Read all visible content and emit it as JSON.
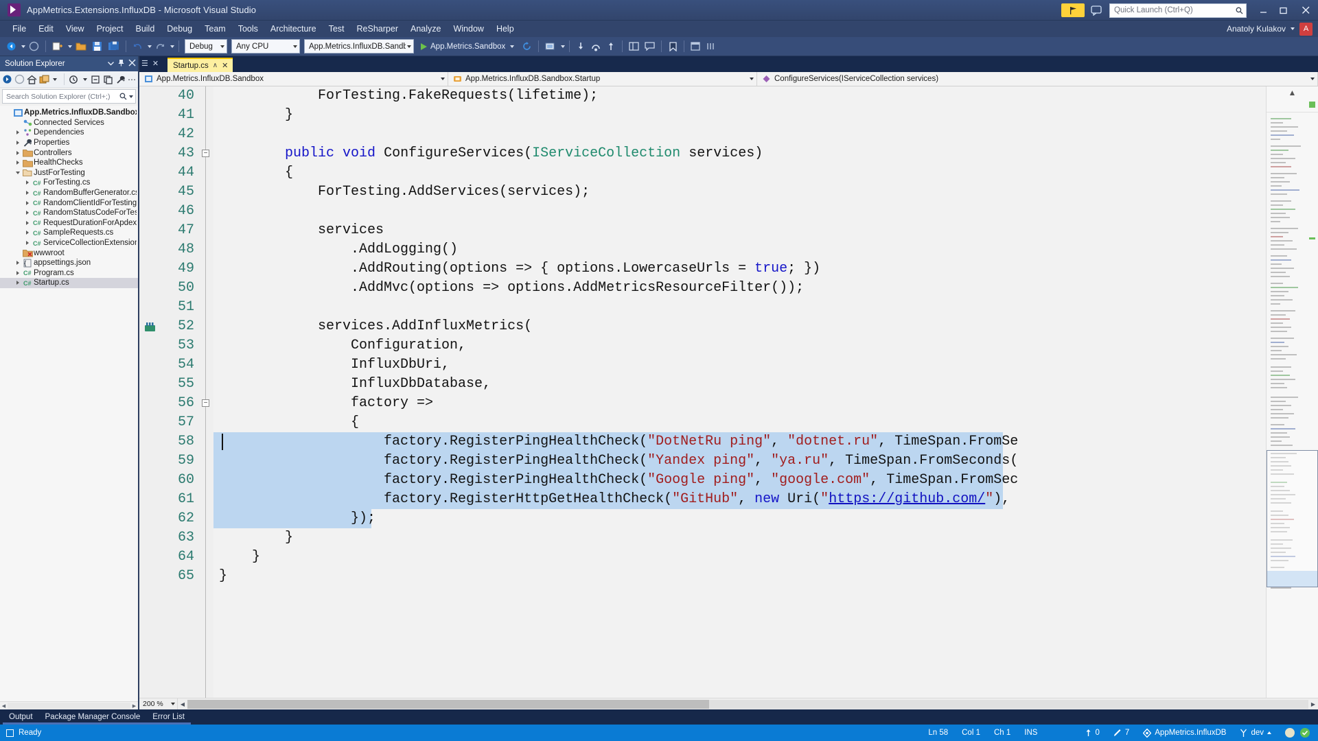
{
  "window": {
    "title": "AppMetrics.Extensions.InfluxDB - Microsoft Visual Studio",
    "logo_icon": "visual-studio-logo-icon",
    "notifications_icon": "notification-flag-icon",
    "feedback_icon": "feedback-smiley-icon",
    "minimize_icon": "minimize-icon",
    "maximize_icon": "maximize-icon",
    "close_icon": "close-icon",
    "quick_launch_placeholder": "Quick Launch (Ctrl+Q)",
    "quick_launch_icon": "search-icon"
  },
  "menu": {
    "items": [
      "File",
      "Edit",
      "View",
      "Project",
      "Build",
      "Debug",
      "Team",
      "Tools",
      "Architecture",
      "Test",
      "ReSharper",
      "Analyze",
      "Window",
      "Help"
    ],
    "user_name": "Anatoly Kulakov",
    "user_initials": "A"
  },
  "toolbar": {
    "back_icon": "navigate-backward-icon",
    "forward_icon": "navigate-forward-icon",
    "new_project_icon": "new-project-icon",
    "open_icon": "open-file-icon",
    "save_icon": "save-icon",
    "save_all_icon": "save-all-icon",
    "undo_icon": "undo-icon",
    "redo_icon": "redo-icon",
    "configuration": "Debug",
    "platform": "Any CPU",
    "startup_project": "App.Metrics.InfluxDB.Sandbox",
    "run_label": "App.Metrics.Sandbox",
    "run_icon": "play-icon",
    "refresh_icon": "refresh-icon",
    "attach_icon": "attach-to-process-icon",
    "step_icons": [
      "step-into-icon",
      "step-over-icon",
      "step-out-icon"
    ],
    "layout_icons": [
      "panel-layout-icon",
      "comment-icon"
    ],
    "bookmark_icon": "bookmark-icon",
    "misc_icons": [
      "tool-window-icon",
      "options-icon"
    ]
  },
  "solution_explorer": {
    "title": "Solution Explorer",
    "dropdown_icon": "chevron-down-icon",
    "pin_icon": "pin-icon",
    "close_icon": "close-icon",
    "toolbar_icons": [
      "forward-navigate-icon",
      "back-navigate-icon",
      "home-icon",
      "solution-view-icon",
      "dropdown-icon",
      "pending-changes-icon",
      "collapse-all-icon",
      "show-all-files-icon",
      "properties-wrench-icon",
      "overflow-icon"
    ],
    "search_placeholder": "Search Solution Explorer (Ctrl+;)",
    "search_icon": "search-icon",
    "tree": [
      {
        "label": "App.Metrics.InfluxDB.Sandbox",
        "indent": 0,
        "twisty": "",
        "icon": "project-icon",
        "bold": true,
        "selected": false
      },
      {
        "label": "Connected Services",
        "indent": 1,
        "twisty": "",
        "icon": "connected-services-icon",
        "bold": false,
        "selected": false
      },
      {
        "label": "Dependencies",
        "indent": 1,
        "twisty": "right",
        "icon": "dependencies-icon",
        "bold": false,
        "selected": false
      },
      {
        "label": "Properties",
        "indent": 1,
        "twisty": "right",
        "icon": "properties-icon",
        "bold": false,
        "selected": false
      },
      {
        "label": "Controllers",
        "indent": 1,
        "twisty": "right",
        "icon": "folder-icon",
        "bold": false,
        "selected": false
      },
      {
        "label": "HealthChecks",
        "indent": 1,
        "twisty": "right",
        "icon": "folder-icon",
        "bold": false,
        "selected": false
      },
      {
        "label": "JustForTesting",
        "indent": 1,
        "twisty": "down",
        "icon": "folder-open-icon",
        "bold": false,
        "selected": false
      },
      {
        "label": "ForTesting.cs",
        "indent": 2,
        "twisty": "right",
        "icon": "csharp-file-icon",
        "bold": false,
        "selected": false
      },
      {
        "label": "RandomBufferGenerator.cs",
        "indent": 2,
        "twisty": "right",
        "icon": "csharp-file-icon",
        "bold": false,
        "selected": false
      },
      {
        "label": "RandomClientIdForTesting.cs",
        "indent": 2,
        "twisty": "right",
        "icon": "csharp-file-icon",
        "bold": false,
        "selected": false
      },
      {
        "label": "RandomStatusCodeForTesting.c",
        "indent": 2,
        "twisty": "right",
        "icon": "csharp-file-icon",
        "bold": false,
        "selected": false
      },
      {
        "label": "RequestDurationForApdexTestin",
        "indent": 2,
        "twisty": "right",
        "icon": "csharp-file-icon",
        "bold": false,
        "selected": false
      },
      {
        "label": "SampleRequests.cs",
        "indent": 2,
        "twisty": "right",
        "icon": "csharp-file-icon",
        "bold": false,
        "selected": false
      },
      {
        "label": "ServiceCollectionExtensions.cs",
        "indent": 2,
        "twisty": "right",
        "icon": "csharp-file-icon",
        "bold": false,
        "selected": false
      },
      {
        "label": "wwwroot",
        "indent": 1,
        "twisty": "",
        "icon": "wwwroot-folder-icon",
        "bold": false,
        "selected": false
      },
      {
        "label": "appsettings.json",
        "indent": 1,
        "twisty": "right",
        "icon": "json-file-icon",
        "bold": false,
        "selected": false
      },
      {
        "label": "Program.cs",
        "indent": 1,
        "twisty": "right",
        "icon": "csharp-file-icon",
        "bold": false,
        "selected": false
      },
      {
        "label": "Startup.cs",
        "indent": 1,
        "twisty": "right",
        "icon": "csharp-file-icon",
        "bold": false,
        "selected": true
      }
    ]
  },
  "editor": {
    "tab": {
      "label": "Startup.cs",
      "pin_glyph": "pin-icon",
      "close_glyph": "close-icon"
    },
    "navbar": {
      "project": "App.Metrics.InfluxDB.Sandbox",
      "project_icon": "project-icon",
      "type": "App.Metrics.InfluxDB.Sandbox.Startup",
      "type_icon": "class-icon",
      "member": "ConfigureServices(IServiceCollection services)",
      "member_icon": "method-icon"
    },
    "first_line": 40,
    "zoom": "200 %",
    "bookmark_icon": "bookmark-glyph-icon",
    "lines": [
      {
        "n": 40,
        "fold": "",
        "sel": 0,
        "tokens": [
          {
            "t": "            ForTesting.",
            "c": "plain"
          },
          {
            "t": "FakeRequests",
            "c": "plain"
          },
          {
            "t": "(lifetime);",
            "c": "plain"
          }
        ]
      },
      {
        "n": 41,
        "fold": "",
        "sel": 0,
        "tokens": [
          {
            "t": "        }",
            "c": "plain"
          }
        ]
      },
      {
        "n": 42,
        "fold": "",
        "sel": 0,
        "tokens": [
          {
            "t": "",
            "c": "plain"
          }
        ]
      },
      {
        "n": 43,
        "fold": "minus",
        "sel": 0,
        "tokens": [
          {
            "t": "        ",
            "c": "plain"
          },
          {
            "t": "public",
            "c": "kw"
          },
          {
            "t": " ",
            "c": "plain"
          },
          {
            "t": "void",
            "c": "kw"
          },
          {
            "t": " ",
            "c": "plain"
          },
          {
            "t": "ConfigureServices",
            "c": "plain"
          },
          {
            "t": "(",
            "c": "plain"
          },
          {
            "t": "IServiceCollection",
            "c": "type"
          },
          {
            "t": " services)",
            "c": "plain"
          }
        ]
      },
      {
        "n": 44,
        "fold": "",
        "sel": 0,
        "tokens": [
          {
            "t": "        {",
            "c": "plain"
          }
        ]
      },
      {
        "n": 45,
        "fold": "",
        "sel": 0,
        "tokens": [
          {
            "t": "            ForTesting.AddServices(services);",
            "c": "plain"
          }
        ]
      },
      {
        "n": 46,
        "fold": "",
        "sel": 0,
        "tokens": [
          {
            "t": "",
            "c": "plain"
          }
        ]
      },
      {
        "n": 47,
        "fold": "",
        "sel": 0,
        "tokens": [
          {
            "t": "            services",
            "c": "plain"
          }
        ]
      },
      {
        "n": 48,
        "fold": "",
        "sel": 0,
        "tokens": [
          {
            "t": "                .AddLogging()",
            "c": "plain"
          }
        ]
      },
      {
        "n": 49,
        "fold": "",
        "sel": 0,
        "tokens": [
          {
            "t": "                .AddRouting(options => { options.LowercaseUrls = ",
            "c": "plain"
          },
          {
            "t": "true",
            "c": "kw"
          },
          {
            "t": "; })",
            "c": "plain"
          }
        ]
      },
      {
        "n": 50,
        "fold": "",
        "sel": 0,
        "tokens": [
          {
            "t": "                .AddMvc(options => options.AddMetricsResourceFilter());",
            "c": "plain"
          }
        ]
      },
      {
        "n": 51,
        "fold": "",
        "sel": 0,
        "tokens": [
          {
            "t": "",
            "c": "plain"
          }
        ]
      },
      {
        "n": 52,
        "fold": "",
        "sel": 0,
        "tokens": [
          {
            "t": "            services.AddInfluxMetrics(",
            "c": "plain"
          }
        ]
      },
      {
        "n": 53,
        "fold": "",
        "sel": 0,
        "tokens": [
          {
            "t": "                Configuration,",
            "c": "plain"
          }
        ]
      },
      {
        "n": 54,
        "fold": "",
        "sel": 0,
        "tokens": [
          {
            "t": "                InfluxDbUri,",
            "c": "plain"
          }
        ]
      },
      {
        "n": 55,
        "fold": "",
        "sel": 0,
        "tokens": [
          {
            "t": "                InfluxDbDatabase,",
            "c": "plain"
          }
        ]
      },
      {
        "n": 56,
        "fold": "minus",
        "sel": 0,
        "tokens": [
          {
            "t": "                factory =>",
            "c": "plain"
          }
        ]
      },
      {
        "n": 57,
        "fold": "",
        "sel": 0,
        "tokens": [
          {
            "t": "                {",
            "c": "plain"
          }
        ]
      },
      {
        "n": 58,
        "fold": "",
        "sel": 1150,
        "tokens": [
          {
            "t": "                    factory.RegisterPingHealthCheck(",
            "c": "plain"
          },
          {
            "t": "\"DotNetRu ping\"",
            "c": "str"
          },
          {
            "t": ", ",
            "c": "plain"
          },
          {
            "t": "\"dotnet.ru\"",
            "c": "str"
          },
          {
            "t": ", TimeSpan.FromSe",
            "c": "plain"
          }
        ]
      },
      {
        "n": 59,
        "fold": "",
        "sel": 1150,
        "tokens": [
          {
            "t": "                    factory.RegisterPingHealthCheck(",
            "c": "plain"
          },
          {
            "t": "\"Yandex ping\"",
            "c": "str"
          },
          {
            "t": ", ",
            "c": "plain"
          },
          {
            "t": "\"ya.ru\"",
            "c": "str"
          },
          {
            "t": ", TimeSpan.FromSeconds(",
            "c": "plain"
          }
        ]
      },
      {
        "n": 60,
        "fold": "",
        "sel": 1150,
        "tokens": [
          {
            "t": "                    factory.RegisterPingHealthCheck(",
            "c": "plain"
          },
          {
            "t": "\"Google ping\"",
            "c": "str"
          },
          {
            "t": ", ",
            "c": "plain"
          },
          {
            "t": "\"google.com\"",
            "c": "str"
          },
          {
            "t": ", TimeSpan.FromSec",
            "c": "plain"
          }
        ]
      },
      {
        "n": 61,
        "fold": "",
        "sel": 1150,
        "tokens": [
          {
            "t": "                    factory.RegisterHttpGetHealthCheck(",
            "c": "plain"
          },
          {
            "t": "\"GitHub\"",
            "c": "str"
          },
          {
            "t": ", ",
            "c": "plain"
          },
          {
            "t": "new",
            "c": "kw"
          },
          {
            "t": " Uri(",
            "c": "plain"
          },
          {
            "t": "\"",
            "c": "str"
          },
          {
            "t": "https://github.com/",
            "c": "link"
          },
          {
            "t": "\"",
            "c": "str"
          },
          {
            "t": "),",
            "c": "plain"
          }
        ]
      },
      {
        "n": 62,
        "fold": "",
        "sel": 230,
        "tokens": [
          {
            "t": "                });",
            "c": "plain"
          }
        ]
      },
      {
        "n": 63,
        "fold": "",
        "sel": 0,
        "tokens": [
          {
            "t": "        }",
            "c": "plain"
          }
        ]
      },
      {
        "n": 64,
        "fold": "",
        "sel": 0,
        "tokens": [
          {
            "t": "    }",
            "c": "plain"
          }
        ]
      },
      {
        "n": 65,
        "fold": "",
        "sel": 0,
        "tokens": [
          {
            "t": "}",
            "c": "plain"
          }
        ]
      }
    ]
  },
  "panels": {
    "tabs": [
      {
        "label": "Output",
        "active": true
      },
      {
        "label": "Package Manager Console",
        "active": true
      },
      {
        "label": "Error List",
        "active": true
      }
    ]
  },
  "status": {
    "ready": "Ready",
    "ready_icon": "status-square-icon",
    "line": "Ln 58",
    "col": "Col 1",
    "ch": "Ch 1",
    "ins": "INS",
    "ahead": "0",
    "ahead_icon": "arrow-up-icon",
    "changes": "7",
    "changes_icon": "pencil-icon",
    "repo": "AppMetrics.InfluxDB",
    "repo_icon": "source-control-icon",
    "branch": "dev",
    "branch_icon": "branch-icon",
    "branch_caret_icon": "chevron-up-icon",
    "notify_icon": "notifications-icon",
    "check_icon": "check-circle-icon",
    "accent": "#0a7bd4"
  }
}
